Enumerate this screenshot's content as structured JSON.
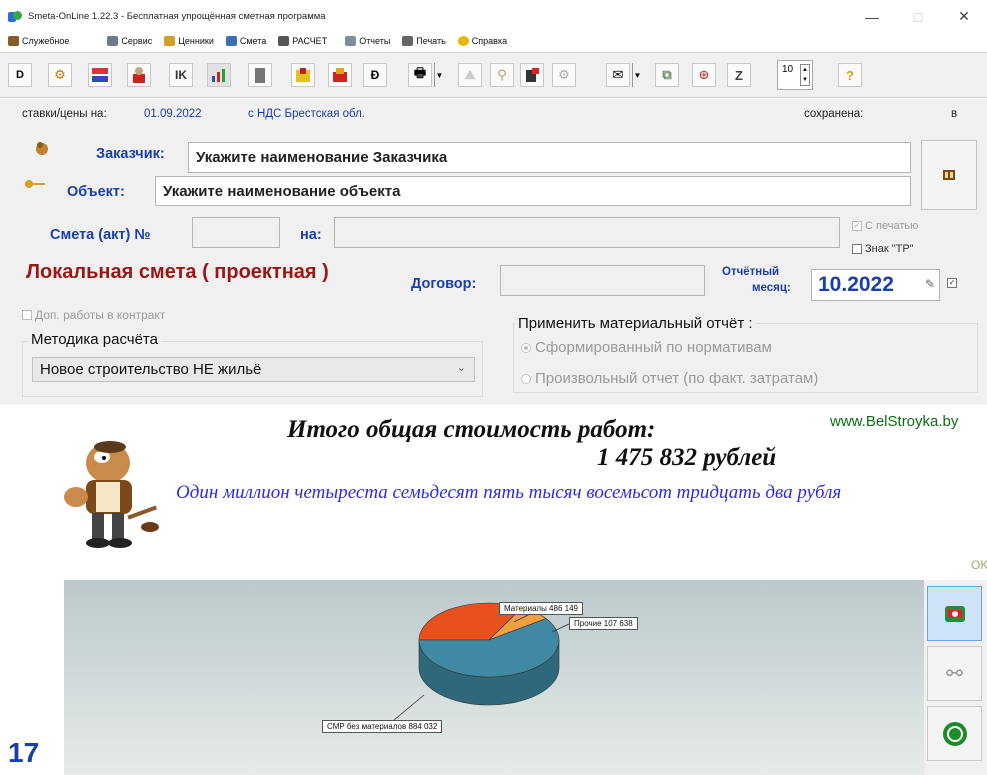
{
  "window": {
    "title": "Smeta-OnLine  1.22.3  - Бесплатная упрощённая сметная программа",
    "minimize": "—",
    "maximize": "□",
    "close": "✕"
  },
  "menu": [
    "Служебное",
    "Сервис",
    "Ценники",
    "Смета",
    "РАСЧЕТ",
    "Отчеты",
    "Печать",
    "Справка"
  ],
  "toolbar": {
    "font_size_value": "10"
  },
  "status": {
    "rates_label": "ставки/цены на:",
    "rates_date": "01.09.2022",
    "vat_region": "с НДС  Брестская обл.",
    "saved_label": "сохранена:",
    "saved_value": "в"
  },
  "form": {
    "customer_label": "Заказчик:",
    "customer_value": "Укажите наименование Заказчика",
    "object_label": "Объект:",
    "object_value": "Укажите наименование объекта",
    "estimate_label": "Смета (акт) №",
    "on_label": "на:",
    "with_print": "С печатью",
    "tr_mark": "Знак \"ТР\"",
    "estimate_type": "Локальная смета ( проектная )",
    "contract_label": "Договор:",
    "report_month_label_1": "Отчётный",
    "report_month_label_2": "месяц:",
    "report_month": "10.2022",
    "extra_works": "Доп. работы в контракт",
    "method_label": "Методика расчёта",
    "method_value": "Новое строительство НЕ жильё",
    "material_report_label": "Применить материальный отчёт :",
    "material_report_opt1": "Сформированный по нормативам",
    "material_report_opt2": "Произвольный отчет (по факт. затратам)"
  },
  "totals": {
    "title": "Итого общая стоимость работ:",
    "sum": "1 475 832  рублей",
    "words": "Один миллион четыреста семьдесят пять тысяч восемьсот тридцать два рубля",
    "site": "www.BelStroyka.by",
    "ok": "OK"
  },
  "chart_data": {
    "type": "pie",
    "categories": [
      "Материалы",
      "Прочие",
      "СМР без материалов"
    ],
    "values": [
      486149,
      107638,
      884032
    ],
    "labels": [
      "Материалы 486 149",
      "Прочие 107 638",
      "СМР без материалов 884 032"
    ],
    "colors": [
      "#e8501e",
      "#f0a03c",
      "#3f8aa2"
    ]
  },
  "footer": {
    "number": "17"
  }
}
